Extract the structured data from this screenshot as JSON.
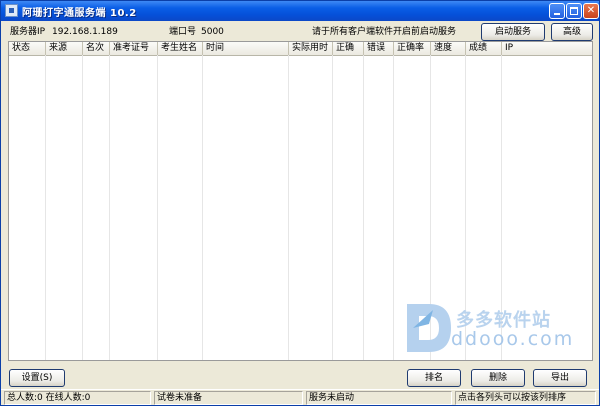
{
  "window": {
    "title": "阿珊打字通服务端 10.2"
  },
  "top": {
    "server_ip_label": "服务器IP",
    "server_ip": "192.168.1.189",
    "port_label": "端口号",
    "port": "5000",
    "hint": "请于所有客户端软件开启前启动服务",
    "start_button": "启动服务",
    "advanced_button": "高级"
  },
  "table": {
    "columns": [
      "状态",
      "来源",
      "名次",
      "准考证号",
      "考生姓名",
      "时间",
      "实际用时",
      "正确",
      "错误",
      "正确率",
      "速度",
      "成绩",
      "IP"
    ],
    "rows": []
  },
  "buttons": {
    "settings": "设置(S)",
    "rank": "排名",
    "delete": "删除",
    "export": "导出"
  },
  "watermark": {
    "cn": "多多软件站",
    "en": "ddooo.com"
  },
  "status": {
    "counts": "总人数:0 在线人数:0",
    "exam": "试卷未准备",
    "service": "服务未启动",
    "sort_hint": "点击各列头可以按该列排序"
  },
  "colors": {
    "title_blue": "#0550d8",
    "close_red": "#c8421c",
    "face": "#ece9d8"
  }
}
